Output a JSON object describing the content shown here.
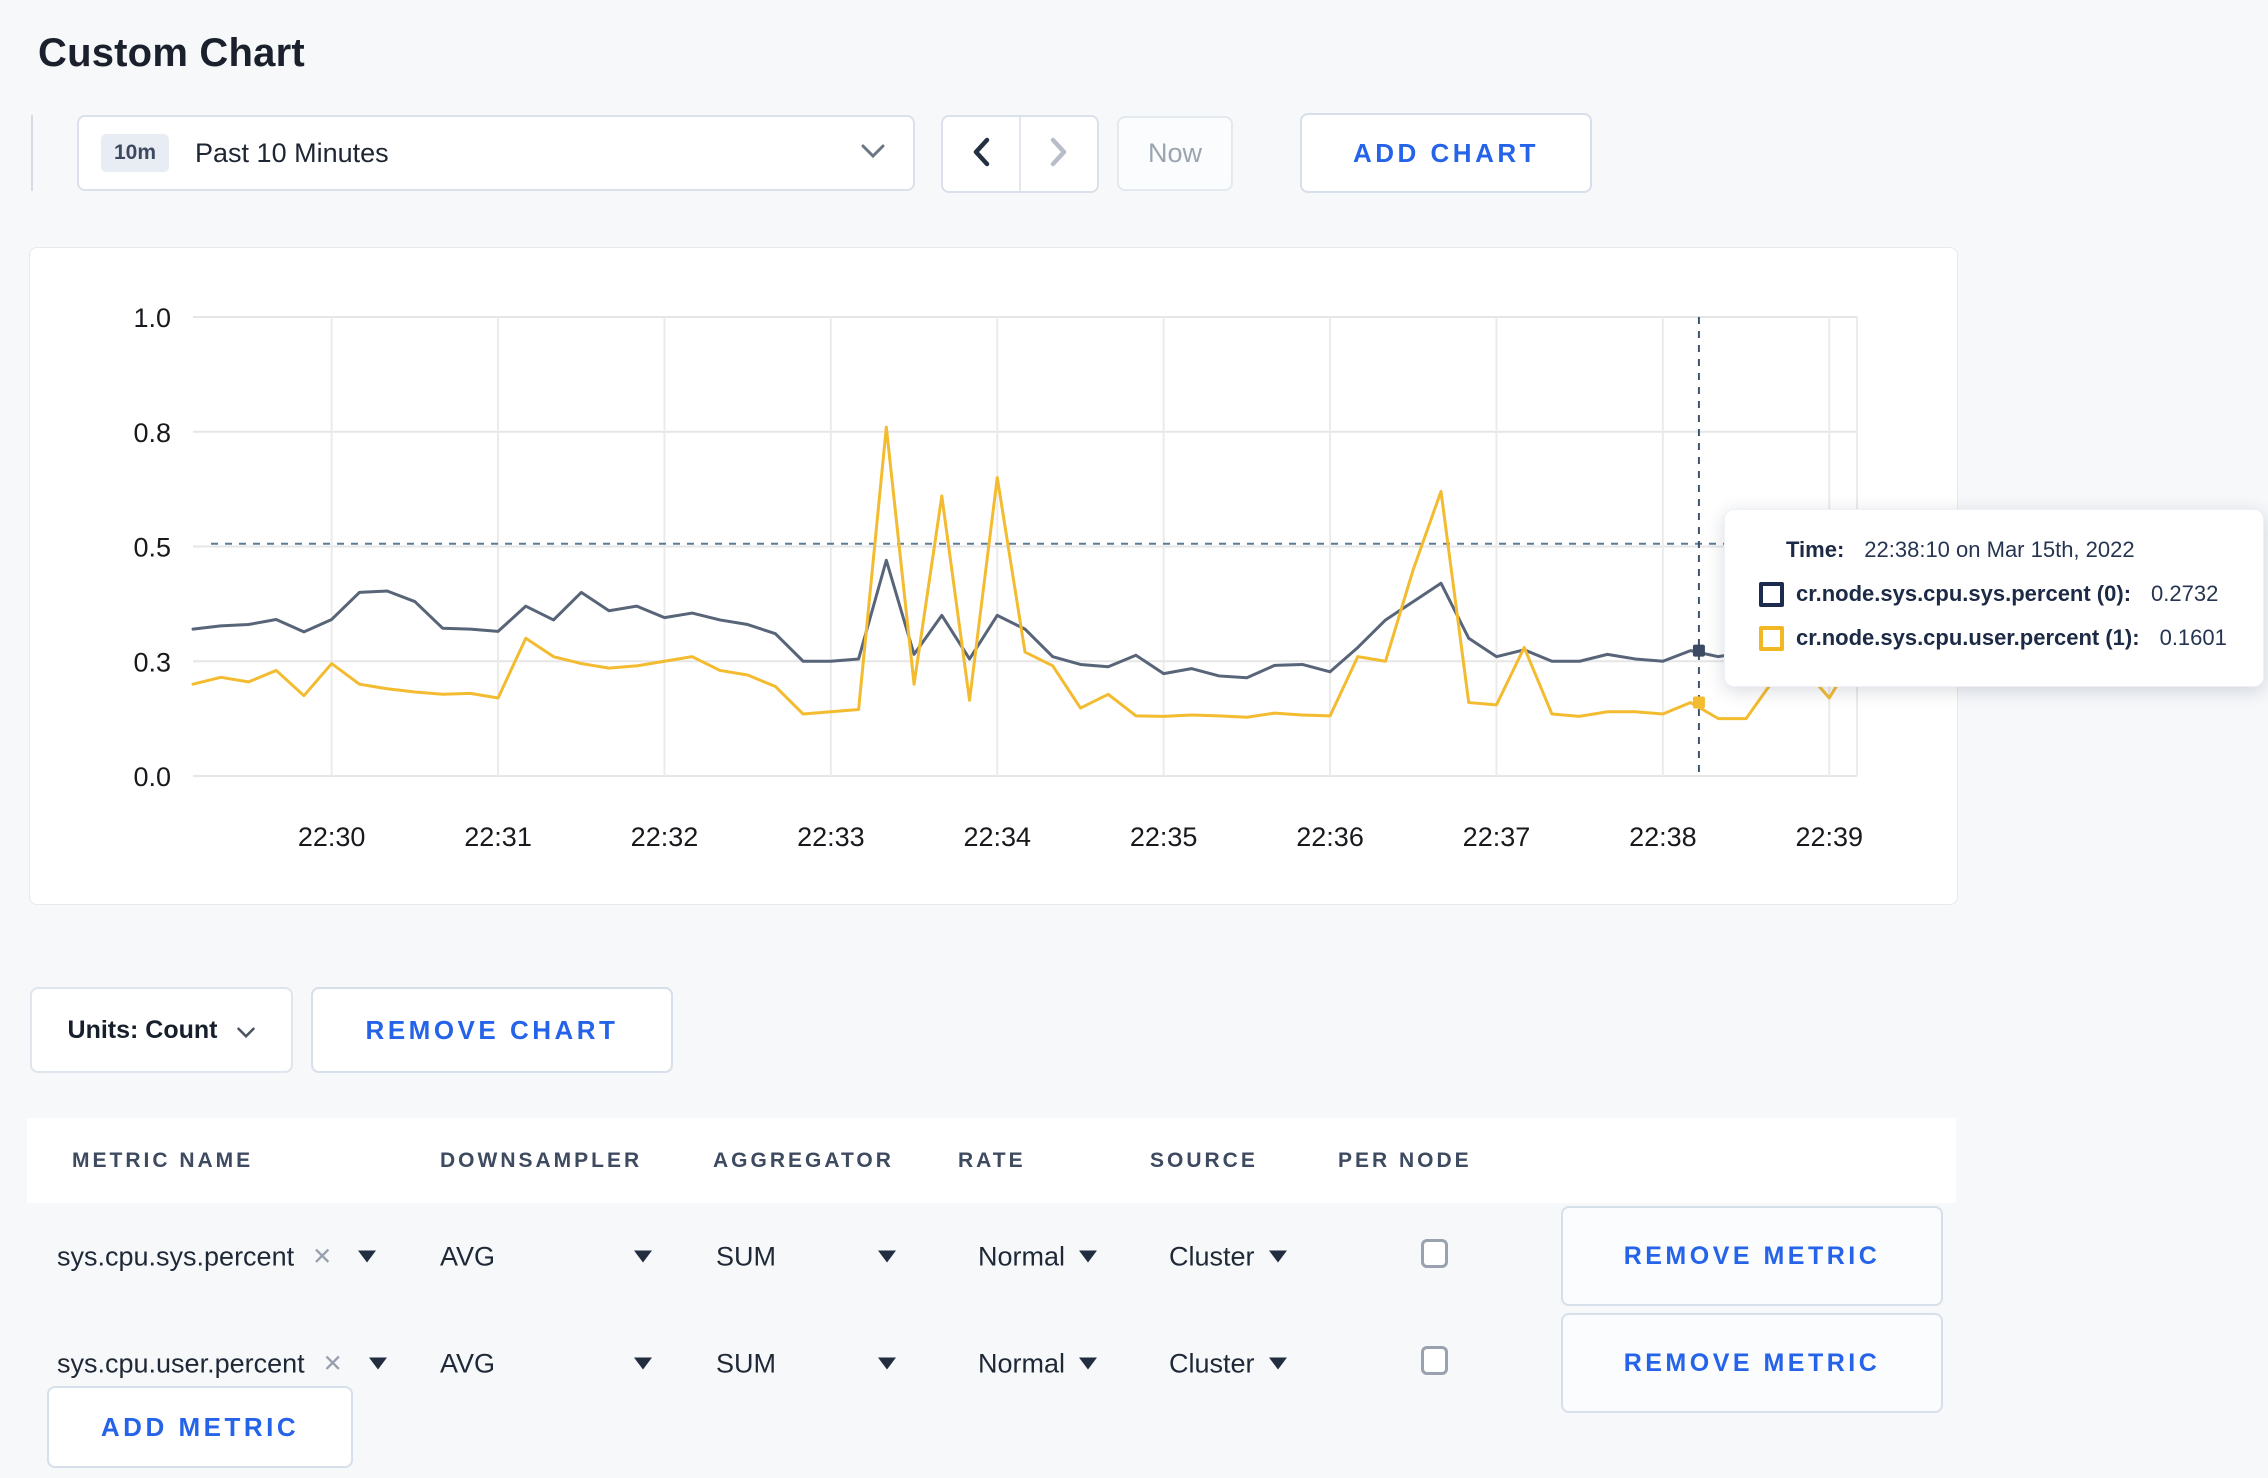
{
  "page": {
    "title": "Custom Chart"
  },
  "toolbar": {
    "time_window_badge": "10m",
    "time_window_label": "Past 10 Minutes",
    "now_label": "Now",
    "add_chart_label": "ADD CHART"
  },
  "chart": {
    "tooltip": {
      "time_label": "Time:",
      "time_value": "22:38:10 on Mar 15th, 2022",
      "series": [
        {
          "name": "cr.node.sys.cpu.sys.percent (0):",
          "value": "0.2732",
          "swatch_color": "#1c2b4e"
        },
        {
          "name": "cr.node.sys.cpu.user.percent (1):",
          "value": "0.1601",
          "swatch_color": "#f2b824"
        }
      ]
    }
  },
  "chart_data": {
    "type": "line",
    "title": "",
    "xlabel": "",
    "ylabel": "",
    "x_window": "22:29:10 to 22:39:10 (Past 10 Minutes)",
    "sample_interval_seconds": 10,
    "x_axis": {
      "tick_seconds": [
        50,
        110,
        170,
        230,
        290,
        350,
        410,
        470,
        530,
        590
      ],
      "tick_labels": [
        "22:30",
        "22:31",
        "22:32",
        "22:33",
        "22:34",
        "22:35",
        "22:36",
        "22:37",
        "22:38",
        "22:39"
      ]
    },
    "y_axis": {
      "range": [
        0,
        1
      ],
      "tick_values": [
        0,
        0.25,
        0.5,
        0.75,
        1.0
      ],
      "tick_labels": [
        "0.0",
        "0.3",
        "0.5",
        "0.8",
        "1.0"
      ]
    },
    "grid": true,
    "legend_position": "none",
    "series": [
      {
        "name": "cr.node.sys.cpu.sys.percent",
        "color": "#586478",
        "values": [
          0.32,
          0.327,
          0.33,
          0.341,
          0.314,
          0.341,
          0.4,
          0.403,
          0.38,
          0.322,
          0.32,
          0.315,
          0.37,
          0.34,
          0.4,
          0.36,
          0.37,
          0.345,
          0.355,
          0.34,
          0.33,
          0.31,
          0.25,
          0.25,
          0.255,
          0.47,
          0.265,
          0.35,
          0.255,
          0.35,
          0.32,
          0.26,
          0.243,
          0.238,
          0.263,
          0.223,
          0.234,
          0.218,
          0.214,
          0.241,
          0.243,
          0.227,
          0.28,
          0.34,
          0.38,
          0.42,
          0.3,
          0.26,
          0.275,
          0.25,
          0.25,
          0.265,
          0.255,
          0.25,
          0.2732,
          0.26,
          0.27,
          0.28,
          0.285,
          0.29,
          0.3
        ]
      },
      {
        "name": "cr.node.sys.cpu.user.percent",
        "color": "#f3bb2f",
        "values": [
          0.2,
          0.215,
          0.205,
          0.23,
          0.175,
          0.245,
          0.2,
          0.19,
          0.183,
          0.178,
          0.18,
          0.17,
          0.3,
          0.26,
          0.245,
          0.235,
          0.24,
          0.25,
          0.26,
          0.23,
          0.22,
          0.195,
          0.135,
          0.14,
          0.145,
          0.76,
          0.2,
          0.61,
          0.165,
          0.65,
          0.27,
          0.24,
          0.148,
          0.178,
          0.131,
          0.13,
          0.133,
          0.131,
          0.128,
          0.137,
          0.133,
          0.131,
          0.26,
          0.25,
          0.45,
          0.62,
          0.16,
          0.155,
          0.28,
          0.135,
          0.13,
          0.14,
          0.14,
          0.135,
          0.1601,
          0.125,
          0.125,
          0.21,
          0.24,
          0.17,
          0.27
        ]
      }
    ],
    "crosshair": {
      "time_seconds": 543,
      "time_label": "22:38:10",
      "mouse_y_value": 0.506,
      "markers": [
        {
          "series": 0,
          "value": 0.2732,
          "color": "#3d4a63"
        },
        {
          "series": 1,
          "value": 0.1601,
          "color": "#f3bb2f"
        }
      ]
    }
  },
  "chart_controls": {
    "units_label": "Units: Count",
    "remove_chart_label": "REMOVE CHART"
  },
  "metrics_table": {
    "headers": [
      "METRIC NAME",
      "DOWNSAMPLER",
      "AGGREGATOR",
      "RATE",
      "SOURCE",
      "PER NODE"
    ],
    "rows": [
      {
        "metric_name": "sys.cpu.sys.percent",
        "downsampler": "AVG",
        "aggregator": "SUM",
        "rate": "Normal",
        "source": "Cluster",
        "per_node_checked": false,
        "remove_label": "REMOVE METRIC"
      },
      {
        "metric_name": "sys.cpu.user.percent",
        "downsampler": "AVG",
        "aggregator": "SUM",
        "rate": "Normal",
        "source": "Cluster",
        "per_node_checked": false,
        "remove_label": "REMOVE METRIC"
      }
    ],
    "add_metric_label": "ADD METRIC"
  },
  "colors": {
    "accent_blue": "#2563e9",
    "page_background": "#f6f8fa",
    "grid_line": "#e7e7e7",
    "crosshair": "#5d7astro"
  }
}
